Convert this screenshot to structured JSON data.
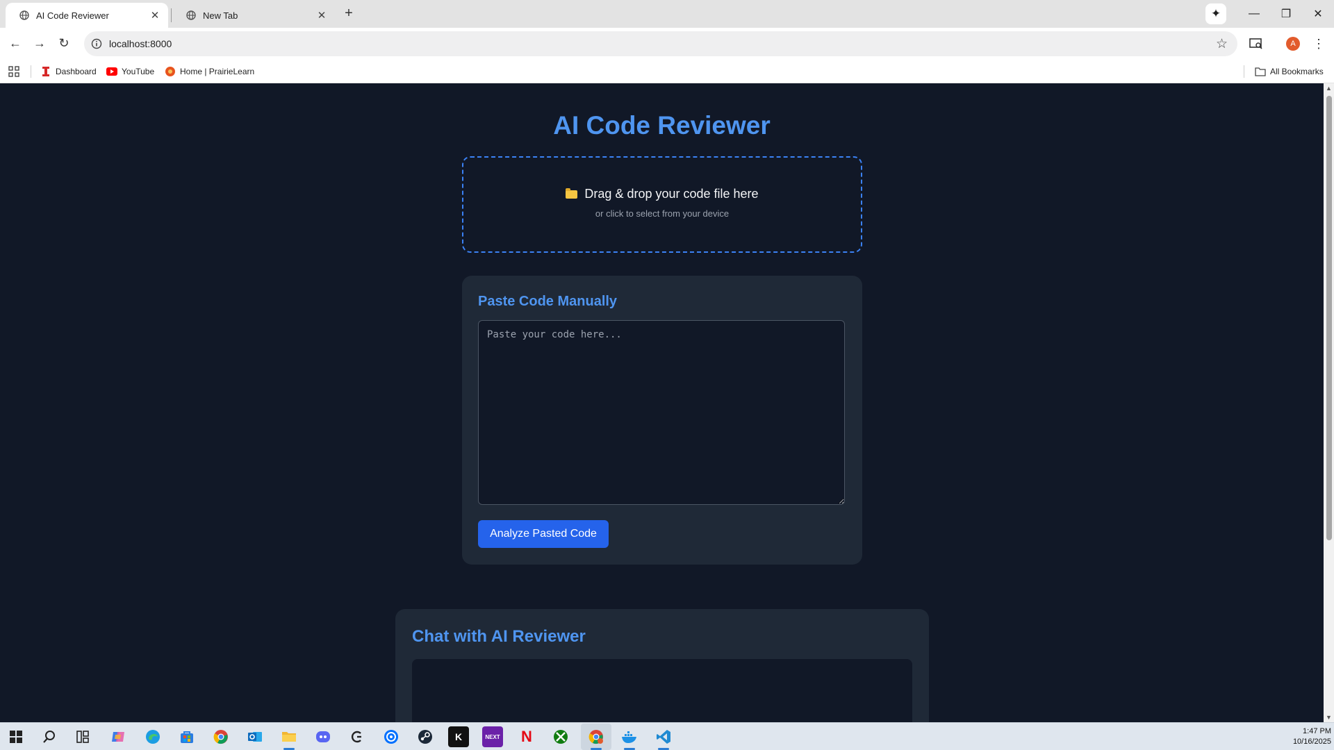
{
  "browser": {
    "tabs": [
      {
        "title": "AI Code Reviewer",
        "active": true
      },
      {
        "title": "New Tab",
        "active": false
      }
    ],
    "url": "localhost:8000",
    "profile_initial": "A",
    "bookmarks": [
      {
        "label": "Dashboard",
        "icon": "canvas-icon",
        "color": "#d62828"
      },
      {
        "label": "YouTube",
        "icon": "youtube-icon",
        "color": "#ff0000"
      },
      {
        "label": "Home | PrairieLearn",
        "icon": "prairielearn-icon",
        "color": "#e8541e"
      }
    ],
    "all_bookmarks_label": "All Bookmarks"
  },
  "page": {
    "title": "AI Code Reviewer",
    "dropzone": {
      "main_text": "Drag & drop your code file here",
      "sub_text": "or click to select from your device",
      "icon": "folder-icon"
    },
    "paste": {
      "heading": "Paste Code Manually",
      "placeholder": "Paste your code here...",
      "value": "",
      "button_label": "Analyze Pasted Code"
    },
    "chat": {
      "heading": "Chat with AI Reviewer"
    }
  },
  "colors": {
    "background": "#111827",
    "card": "#1f2937",
    "accent": "#4f95f0",
    "button": "#2563eb"
  },
  "taskbar": {
    "apps": [
      "start-icon",
      "search-icon",
      "task-view-icon",
      "copilot-icon",
      "edge-icon",
      "store-icon",
      "chrome-icon",
      "outlook-icon",
      "file-explorer-icon",
      "discord-icon",
      "gog-icon",
      "ubisoft-icon",
      "steam-icon",
      "kick-icon",
      "next-icon",
      "netflix-icon",
      "xbox-icon",
      "chrome-profile-icon",
      "docker-icon",
      "vscode-icon"
    ],
    "time": "1:47 PM",
    "date": "10/16/2025"
  }
}
